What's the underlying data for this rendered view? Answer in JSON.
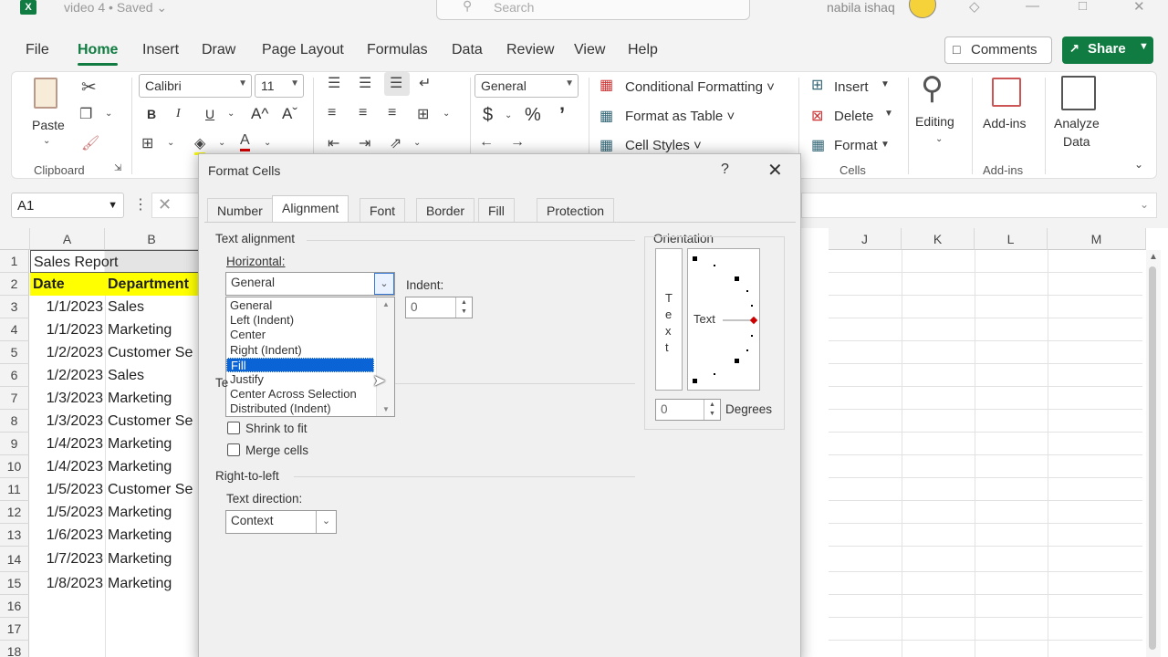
{
  "app": {
    "logo": "X",
    "doc_title": "video 4 • Saved ⌄",
    "search_placeholder": "Search",
    "user_name": "nabila ishaq"
  },
  "menu": {
    "tabs": [
      "File",
      "Home",
      "Insert",
      "Draw",
      "Page Layout",
      "Formulas",
      "Data",
      "Review",
      "View",
      "Help"
    ],
    "active": "Home",
    "comments_label": "Comments",
    "share_label": "Share"
  },
  "ribbon": {
    "clipboard": {
      "paste": "Paste",
      "label": "Clipboard"
    },
    "font": {
      "name": "Calibri",
      "size": "11",
      "bold": "B",
      "italic": "I",
      "underline": "U",
      "grow": "A^",
      "shrink": "Aˇ"
    },
    "number": {
      "format": "General",
      "currency": "$",
      "percent": "%",
      "comma": "’"
    },
    "styles": {
      "conditional": "Conditional Formatting ˅",
      "table": "Format as Table ˅",
      "cell": "Cell Styles ˅"
    },
    "cells": {
      "insert": "Insert",
      "delete": "Delete",
      "format": "Format",
      "label": "Cells"
    },
    "editing": {
      "label": "Editing"
    },
    "addins": {
      "label": "Add-ins",
      "group_label": "Add-ins"
    },
    "analyze": {
      "label1": "Analyze",
      "label2": "Data"
    }
  },
  "formula_bar": {
    "name_box": "A1",
    "dots": "⋮"
  },
  "grid": {
    "columns": [
      "A",
      "B",
      "J",
      "K",
      "L",
      "M"
    ],
    "rows": [
      {
        "n": "1",
        "a": "Sales Report",
        "b": ""
      },
      {
        "n": "2",
        "a": "Date",
        "b": "Department"
      },
      {
        "n": "3",
        "a": "1/1/2023",
        "b": "Sales"
      },
      {
        "n": "4",
        "a": "1/1/2023",
        "b": "Marketing"
      },
      {
        "n": "5",
        "a": "1/2/2023",
        "b": "Customer Se"
      },
      {
        "n": "6",
        "a": "1/2/2023",
        "b": "Sales"
      },
      {
        "n": "7",
        "a": "1/3/2023",
        "b": "Marketing"
      },
      {
        "n": "8",
        "a": "1/3/2023",
        "b": "Customer Se"
      },
      {
        "n": "9",
        "a": "1/4/2023",
        "b": "Marketing"
      },
      {
        "n": "10",
        "a": "1/4/2023",
        "b": "Marketing"
      },
      {
        "n": "11",
        "a": "1/5/2023",
        "b": "Customer Se"
      },
      {
        "n": "12",
        "a": "1/5/2023",
        "b": "Marketing"
      },
      {
        "n": "13",
        "a": "1/6/2023",
        "b": "Marketing"
      },
      {
        "n": "14",
        "a": "1/7/2023",
        "b": "Marketing"
      },
      {
        "n": "15",
        "a": "1/8/2023",
        "b": "Marketing"
      },
      {
        "n": "16",
        "a": "",
        "b": ""
      },
      {
        "n": "17",
        "a": "",
        "b": ""
      },
      {
        "n": "18",
        "a": "",
        "b": ""
      }
    ],
    "header_fill": "#ffff00"
  },
  "dialog": {
    "title": "Format Cells",
    "help": "?",
    "close": "✕",
    "tabs": [
      "Number",
      "Alignment",
      "Font",
      "Border",
      "Fill",
      "Protection"
    ],
    "active_tab": "Alignment",
    "text_alignment": {
      "section": "Text alignment",
      "horizontal_label": "Horizontal:",
      "horizontal_value": "General",
      "options": [
        "General",
        "Left (Indent)",
        "Center",
        "Right (Indent)",
        "Fill",
        "Justify",
        "Center Across Selection",
        "Distributed (Indent)"
      ],
      "selected": "Fill",
      "indent_label": "Indent:",
      "indent_value": "0"
    },
    "text_control": {
      "partial_label": "Te",
      "shrink": "Shrink to fit",
      "merge": "Merge cells"
    },
    "rtl": {
      "section": "Right-to-left",
      "direction_label": "Text direction:",
      "direction_value": "Context"
    },
    "orientation": {
      "section": "Orientation",
      "vertical_letters": [
        "T",
        "e",
        "x",
        "t"
      ],
      "dial_text": "Text",
      "degrees_value": "0",
      "degrees_label": "Degrees"
    }
  },
  "colors": {
    "accent": "#107c41",
    "selection": "#0a64d6"
  }
}
